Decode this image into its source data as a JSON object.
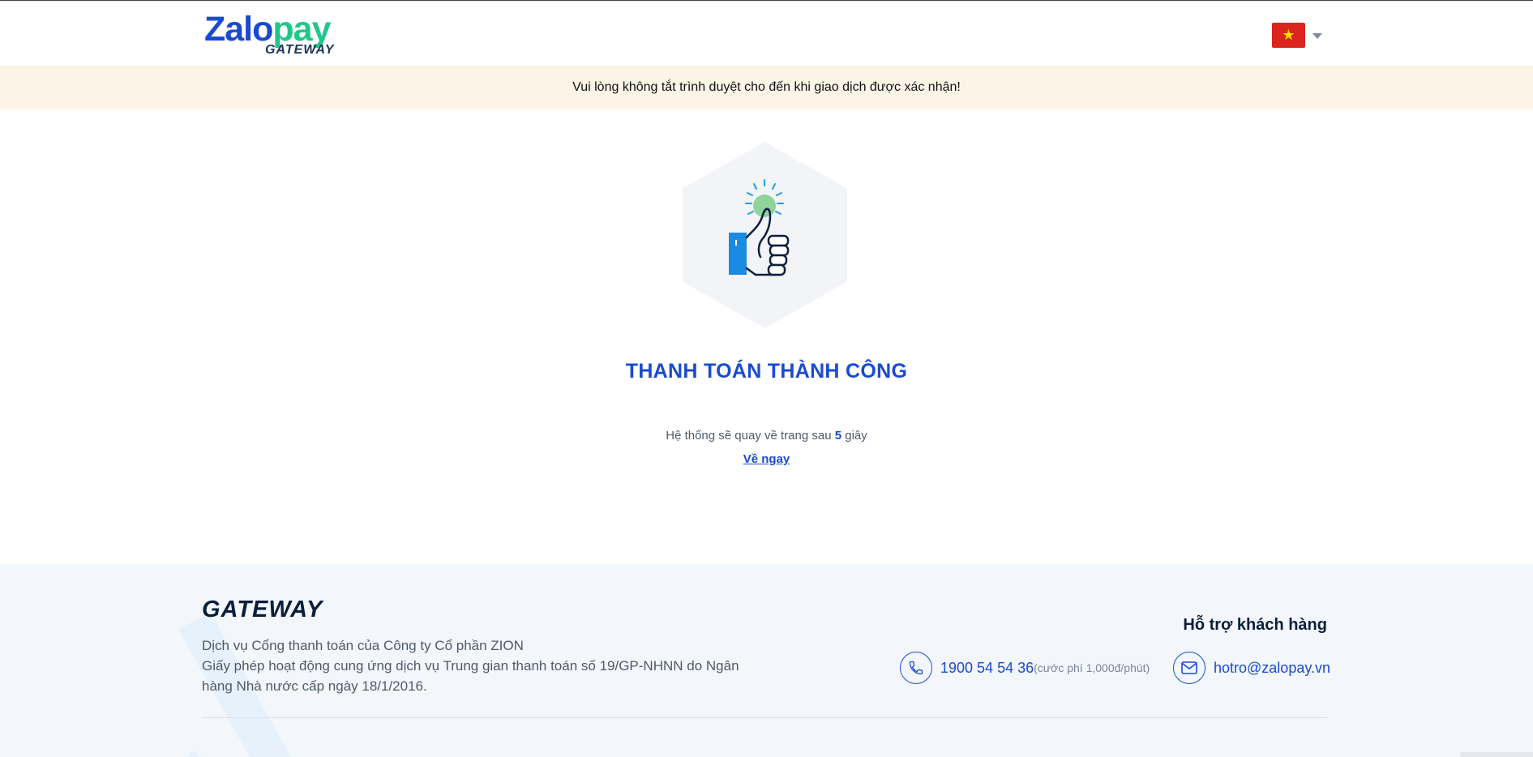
{
  "header": {
    "logo_zalo": "Zalo",
    "logo_pay": "pay",
    "logo_sub": "GATEWAY",
    "language": "vi",
    "flag_star": "★"
  },
  "notice": {
    "text": "Vui lòng không tắt trình duyệt cho đến khi giao dịch được xác nhận!"
  },
  "result": {
    "illustration": "thumbs-up-icon",
    "title": "THANH TOÁN THÀNH CÔNG",
    "countdown_prefix": "Hệ thống sẽ quay về trang sau",
    "countdown_seconds": "5",
    "countdown_suffix": "giây",
    "back_link": "Về ngay"
  },
  "footer": {
    "brand": "GATEWAY",
    "line1": "Dịch vụ Cổng thanh toán của Công ty Cổ phần ZION",
    "line2": "Giấy phép hoạt động cung ứng dịch vụ Trung gian thanh toán số 19/GP-NHNN do Ngân hàng Nhà nước cấp ngày 18/1/2016.",
    "support_title": "Hỗ trợ khách hàng",
    "phone": "1900 54 54 36",
    "phone_note": "(cước phí 1,000đ/phút)",
    "email": "hotro@zalopay.vn"
  },
  "colors": {
    "brand_blue": "#1a4ad0",
    "brand_green": "#1fc78a",
    "notice_bg": "#fdf4e8",
    "footer_bg": "#f3f7fc"
  }
}
